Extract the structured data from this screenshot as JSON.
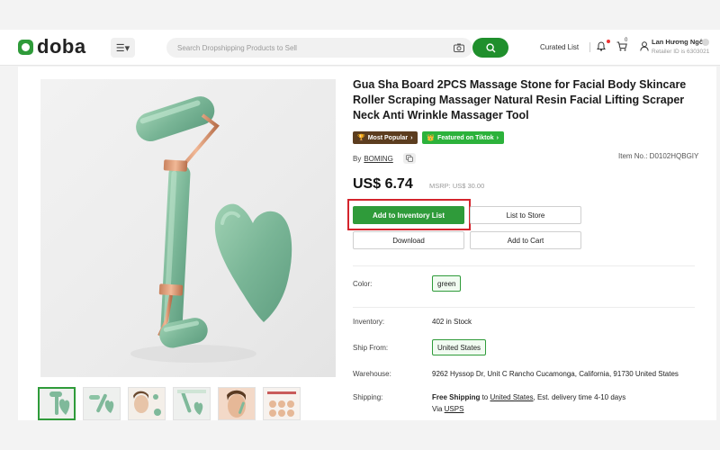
{
  "header": {
    "logo_text": "doba",
    "search_placeholder": "Search Dropshipping Products to Sell",
    "curated_label": "Curated List",
    "cart_count": "0",
    "user_name": "Lan Hương Ngô",
    "retailer_id": "Retailer ID is 6303021",
    "icons": [
      "menu-icon",
      "camera-icon",
      "search-icon",
      "bell-icon",
      "cart-icon",
      "user-icon"
    ]
  },
  "product": {
    "title": "Gua Sha Board 2PCS Massage Stone for Facial Body Skincare Roller Scraping Massager Natural Resin Facial Lifting Scraper Neck Anti Wrinkle Massager Tool",
    "badge_popular": "Most Popular",
    "badge_tiktok": "Featured on Tiktok",
    "by_prefix": "By",
    "brand": "BOMING",
    "item_no": "Item No.: D0102HQBGIY",
    "price": "US$ 6.74",
    "msrp": "MSRP: US$ 30.00",
    "thumbnail_count": 6
  },
  "actions": {
    "add_inventory": "Add to Inventory List",
    "list_store": "List to Store",
    "download": "Download",
    "add_cart": "Add to Cart"
  },
  "specs": {
    "color_label": "Color:",
    "color_value": "green",
    "inventory_label": "Inventory:",
    "inventory_value": "402 in Stock",
    "ship_label": "Ship From:",
    "ship_value": "United States",
    "warehouse_label": "Warehouse:",
    "warehouse_value": "9262 Hyssop Dr, Unit C Rancho Cucamonga, California, 91730 United States",
    "shipping_label": "Shipping:",
    "shipping_free": "Free Shipping",
    "shipping_to": "to",
    "shipping_dest": "United States",
    "shipping_est": ", Est. delivery time 4-10 days",
    "shipping_via": "Via",
    "shipping_carrier": "USPS"
  },
  "colors": {
    "brand_green": "#2f9b3a",
    "highlight_red": "#d4242c",
    "badge_brown": "#5c3d1f",
    "badge_green": "#2cb23b",
    "jade": "#7fb99a"
  }
}
